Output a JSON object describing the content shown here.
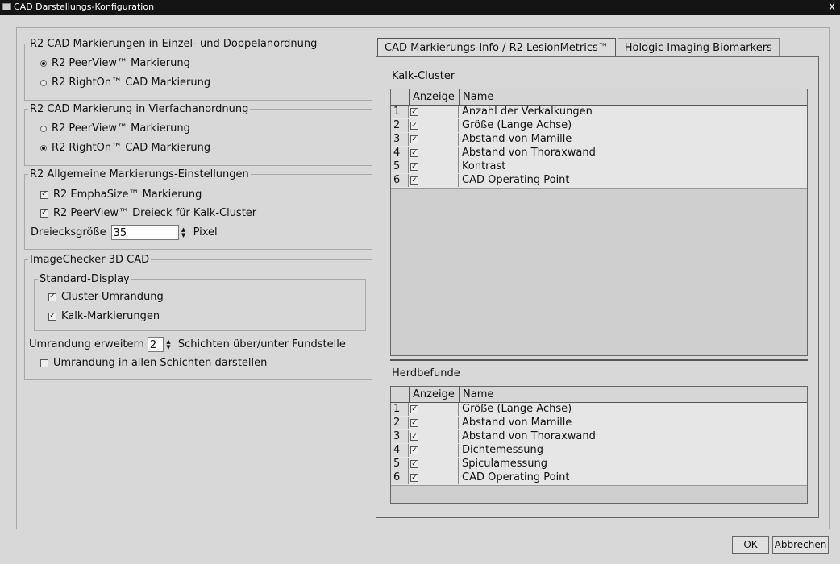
{
  "window": {
    "title": "CAD Darstellungs-Konfiguration",
    "close_glyph": "x"
  },
  "group1": {
    "legend": "R2 CAD Markierungen in Einzel- und Doppelanordnung",
    "options": [
      {
        "label": "R2 PeerView™ Markierung",
        "selected": true
      },
      {
        "label": "R2 RightOn™ CAD Markierung",
        "selected": false
      }
    ]
  },
  "group2": {
    "legend": "R2 CAD Markierung in Vierfachanordnung",
    "options": [
      {
        "label": "R2 PeerView™ Markierung",
        "selected": false
      },
      {
        "label": "R2 RightOn™ CAD Markierung",
        "selected": true
      }
    ]
  },
  "group3": {
    "legend": "R2 Allgemeine Markierungs-Einstellungen",
    "checkboxes": [
      {
        "label": "R2 EmphaSize™ Markierung",
        "checked": true
      },
      {
        "label": "R2 PeerView™ Dreieck für Kalk-Cluster",
        "checked": true
      }
    ],
    "size_label": "Dreiecksgröße",
    "size_value": "35",
    "size_unit": "Pixel"
  },
  "group4": {
    "legend": "ImageChecker 3D CAD",
    "sub_legend": "Standard-Display",
    "checkboxes": [
      {
        "label": "Cluster-Umrandung",
        "checked": true
      },
      {
        "label": "Kalk-Markierungen",
        "checked": true
      }
    ],
    "extend_label": "Umrandung erweitern",
    "extend_value": "2",
    "extend_suffix": "Schichten über/unter Fundstelle",
    "all_layers_label": "Umrandung in allen Schichten darstellen",
    "all_layers_checked": false
  },
  "tabs": [
    {
      "label": "CAD Markierungs-Info / R2 LesionMetrics™",
      "active": true
    },
    {
      "label": "Hologic Imaging Biomarkers",
      "active": false
    }
  ],
  "kalk": {
    "title": "Kalk-Cluster",
    "columns": [
      "Anzeige",
      "Name"
    ],
    "rows": [
      {
        "num": "1",
        "checked": true,
        "name": "Anzahl der Verkalkungen"
      },
      {
        "num": "2",
        "checked": true,
        "name": "Größe (Lange Achse)"
      },
      {
        "num": "3",
        "checked": true,
        "name": "Abstand von Mamille"
      },
      {
        "num": "4",
        "checked": true,
        "name": "Abstand von Thoraxwand"
      },
      {
        "num": "5",
        "checked": true,
        "name": "Kontrast"
      },
      {
        "num": "6",
        "checked": true,
        "name": "CAD Operating Point"
      }
    ]
  },
  "herd": {
    "title": "Herdbefunde",
    "columns": [
      "Anzeige",
      "Name"
    ],
    "rows": [
      {
        "num": "1",
        "checked": true,
        "name": "Größe (Lange Achse)"
      },
      {
        "num": "2",
        "checked": true,
        "name": "Abstand von Mamille"
      },
      {
        "num": "3",
        "checked": true,
        "name": "Abstand von Thoraxwand"
      },
      {
        "num": "4",
        "checked": true,
        "name": "Dichtemessung"
      },
      {
        "num": "5",
        "checked": true,
        "name": "Spiculamessung"
      },
      {
        "num": "6",
        "checked": true,
        "name": "CAD Operating Point"
      }
    ]
  },
  "buttons": {
    "ok": "OK",
    "cancel": "Abbrechen"
  }
}
